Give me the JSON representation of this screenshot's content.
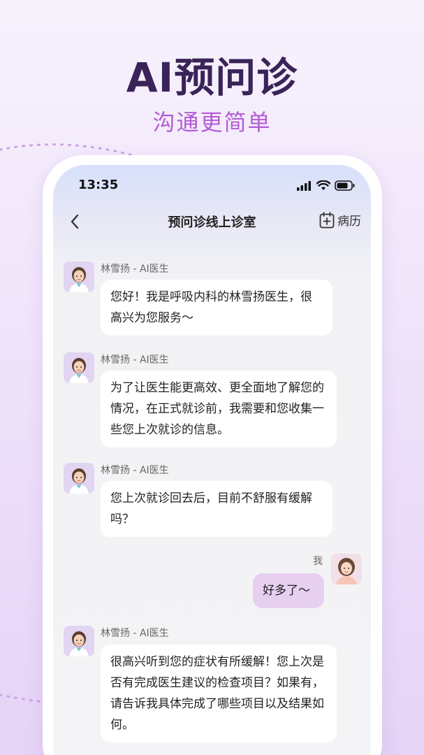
{
  "hero": {
    "title": "AI预问诊",
    "subtitle": "沟通更简单"
  },
  "status_bar": {
    "time": "13:35",
    "icons": [
      "signal-icon",
      "wifi-icon",
      "battery-icon"
    ]
  },
  "nav": {
    "title": "预问诊线上诊室",
    "records_label": "病历",
    "back_icon": "chevron-left-icon",
    "records_icon": "calendar-plus-icon"
  },
  "messages": [
    {
      "sender": "林雪扬 - AI医生",
      "text": "您好！我是呼吸内科的林雪扬医生，很高兴为您服务～",
      "from": "doctor"
    },
    {
      "sender": "林雪扬 - AI医生",
      "text": "为了让医生能更高效、更全面地了解您的情况，在正式就诊前，我需要和您收集一些您上次就诊的信息。",
      "from": "doctor"
    },
    {
      "sender": "林雪扬 - AI医生",
      "text": "您上次就诊回去后，目前不舒服有缓解吗？",
      "from": "doctor"
    },
    {
      "sender": "我",
      "text": "好多了～",
      "from": "me"
    },
    {
      "sender": "林雪扬 - AI医生",
      "text": "很高兴听到您的症状有所缓解！您上次是否有完成医生建议的检查项目？如果有，请告诉我具体完成了哪些项目以及结果如何。",
      "from": "doctor"
    }
  ],
  "colors": {
    "headline": "#3a2358",
    "subline": "#b25cd6",
    "my_bubble": "#e7cff0",
    "doctor_bubble": "#ffffff"
  }
}
